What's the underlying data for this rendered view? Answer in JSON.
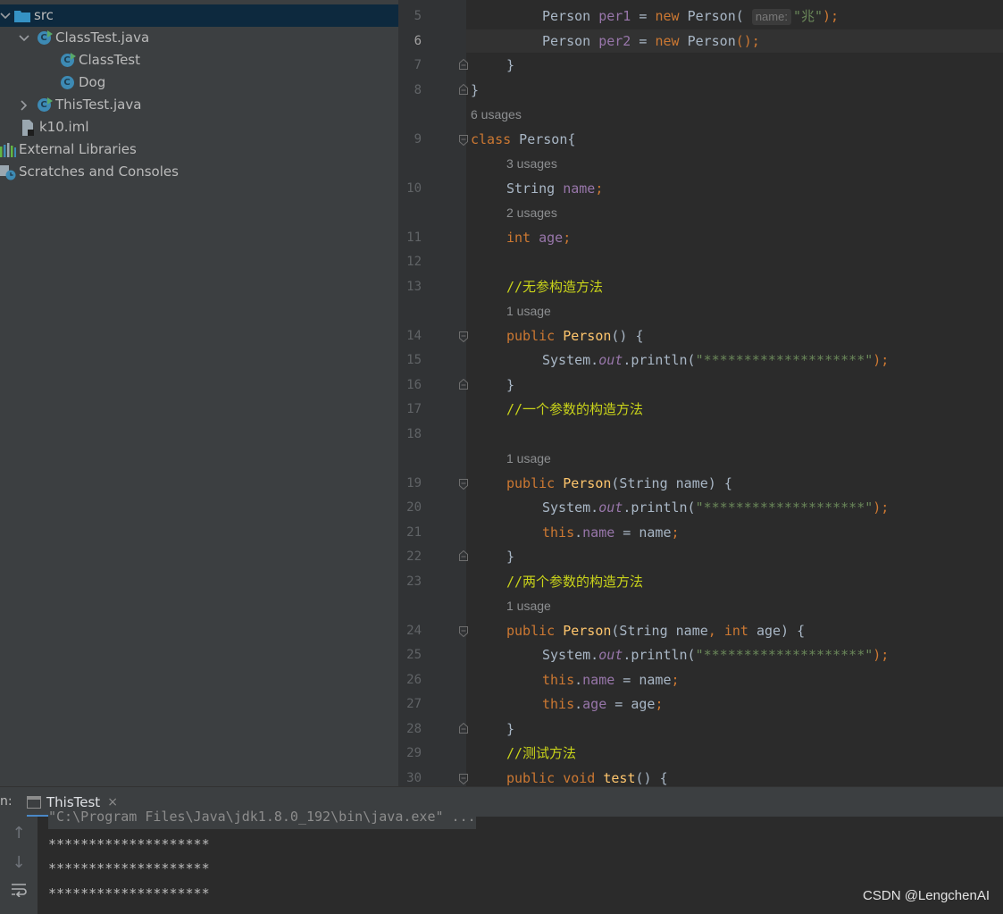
{
  "project_tree": {
    "items": [
      {
        "label": "src",
        "icon": "folder-icon",
        "expanded": true
      },
      {
        "label": "ClassTest.java",
        "icon": "java-class-icon",
        "expanded": true
      },
      {
        "label": "ClassTest",
        "icon": "class-icon"
      },
      {
        "label": "Dog",
        "icon": "class-icon"
      },
      {
        "label": "ThisTest.java",
        "icon": "java-class-icon",
        "expanded": false
      },
      {
        "label": "k10.iml",
        "icon": "iml-file-icon"
      },
      {
        "label": "External Libraries",
        "icon": "libraries-icon"
      },
      {
        "label": "Scratches and Consoles",
        "icon": "scratches-icon"
      }
    ]
  },
  "editor": {
    "current_line": "6",
    "line_numbers": [
      "5",
      "6",
      "7",
      "8",
      "9",
      "10",
      "11",
      "12",
      "13",
      "14",
      "15",
      "16",
      "17",
      "18",
      "19",
      "20",
      "21",
      "22",
      "23",
      "24",
      "25",
      "26",
      "27",
      "28",
      "29",
      "30"
    ],
    "usages": [
      "6 usages",
      "3 usages",
      "2 usages",
      "1 usage",
      "1 usage",
      "1 usage"
    ],
    "param_hint": "name:",
    "tokens": {
      "person": "Person",
      "per1": "per1",
      "per2": "per2",
      "new": "new",
      "eq": " = ",
      "str_zhao": "\"兆\"",
      "close_semi": ");",
      "empty_call": "();",
      "rbrace": "}",
      "class_kw": "class",
      "class_decl": " Person{",
      "string_type": "String",
      "name": "name",
      "semi": ";",
      "int": "int",
      "age": "age",
      "cmt_noarg": "//无参构造方法",
      "public": "public",
      "ctor_noarg": "() {",
      "system": "System.",
      "out": "out",
      "println": ".println(",
      "stars": "\"********************\"",
      "cmt_onearg": "//一个参数的构造方法",
      "ctor_str_name": "(String name) {",
      "this": "this",
      "dot": ".",
      "assign_name": " = name",
      "cmt_twoarg": "//两个参数的构造方法",
      "ctor_two_a": "(String name",
      "comma": ", ",
      "ctor_two_b": " age) {",
      "assign_age": " = age",
      "cmt_test": "//测试方法",
      "void": "void",
      "test": "test",
      "test_sig": "() {"
    }
  },
  "run_panel": {
    "label": "n:",
    "tab_label": "ThisTest",
    "tab_close": "×",
    "command": "\"C:\\Program Files\\Java\\jdk1.8.0_192\\bin\\java.exe\" ...",
    "output": [
      "********************",
      "********************",
      "********************"
    ]
  },
  "watermark": "CSDN @LengchenAI"
}
